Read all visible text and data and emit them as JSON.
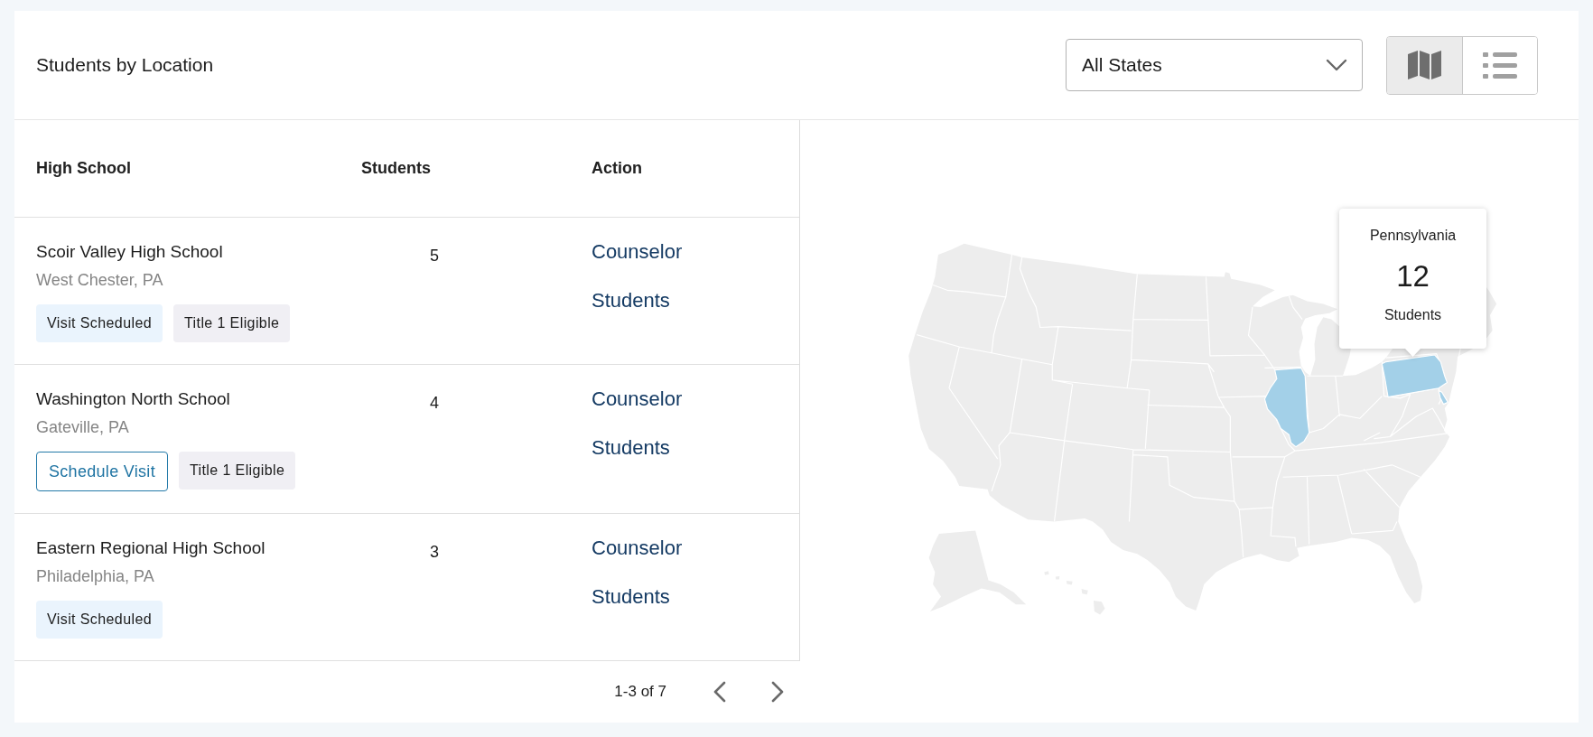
{
  "header": {
    "title": "Students by Location",
    "state_filter": {
      "value": "All States"
    },
    "view_toggle": [
      {
        "kind": "map",
        "selected": true
      },
      {
        "kind": "list",
        "selected": false
      }
    ]
  },
  "table": {
    "columns": [
      "High School",
      "Students",
      "Action"
    ],
    "rows": [
      {
        "school": "Scoir Valley High School",
        "location": "West Chester, PA",
        "students": "5",
        "tags": [
          {
            "kind": "status",
            "label": "Visit Scheduled"
          },
          {
            "kind": "eligibility",
            "label": "Title 1 Eligible"
          }
        ],
        "actions": [
          "Counselor",
          "Students"
        ]
      },
      {
        "school": "Washington North School",
        "location": "Gateville, PA",
        "students": "4",
        "tags": [
          {
            "kind": "action",
            "label": "Schedule Visit"
          },
          {
            "kind": "eligibility",
            "label": "Title 1 Eligible"
          }
        ],
        "actions": [
          "Counselor",
          "Students"
        ]
      },
      {
        "school": "Eastern Regional High School",
        "location": "Philadelphia, PA",
        "students": "3",
        "tags": [
          {
            "kind": "status",
            "label": "Visit Scheduled"
          }
        ],
        "actions": [
          "Counselor",
          "Students"
        ]
      }
    ]
  },
  "pagination": {
    "range": "1-3 of 7"
  },
  "map": {
    "regions": [
      {
        "kind": "illinois",
        "highlighted": true
      },
      {
        "kind": "pennsylvania",
        "highlighted": true
      },
      {
        "kind": "delaware",
        "highlighted": true
      }
    ],
    "tooltip": {
      "title": "Pennsylvania",
      "count": "12",
      "label": "Students"
    }
  }
}
